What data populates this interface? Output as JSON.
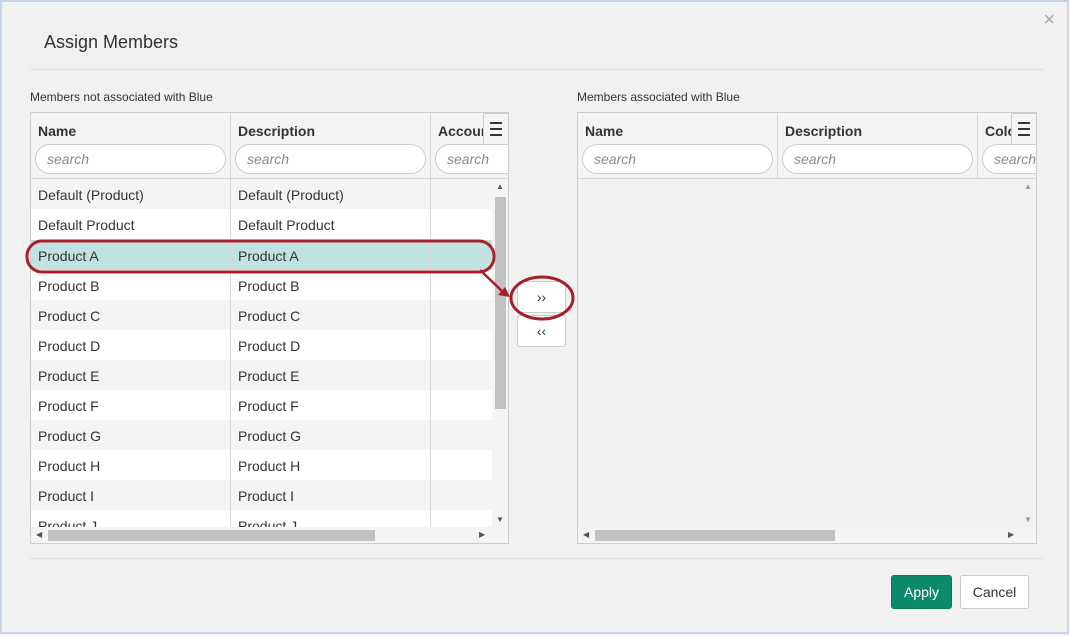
{
  "dialog": {
    "title": "Assign Members",
    "close_label": "×"
  },
  "left": {
    "label": "Members not associated with Blue",
    "columns": [
      {
        "label": "Name",
        "placeholder": "search"
      },
      {
        "label": "Description",
        "placeholder": "search"
      },
      {
        "label": "Account",
        "placeholder": "search"
      }
    ],
    "rows": [
      {
        "name": "Default (Product)",
        "description": "Default (Product)"
      },
      {
        "name": "Default Product",
        "description": "Default Product"
      },
      {
        "name": "Product A",
        "description": "Product A",
        "selected": true
      },
      {
        "name": "Product B",
        "description": "Product B"
      },
      {
        "name": "Product C",
        "description": "Product C"
      },
      {
        "name": "Product D",
        "description": "Product D"
      },
      {
        "name": "Product E",
        "description": "Product E"
      },
      {
        "name": "Product F",
        "description": "Product F"
      },
      {
        "name": "Product G",
        "description": "Product G"
      },
      {
        "name": "Product H",
        "description": "Product H"
      },
      {
        "name": "Product I",
        "description": "Product I"
      },
      {
        "name": "Product J",
        "description": "Product J"
      }
    ]
  },
  "right": {
    "label": "Members associated with Blue",
    "columns": [
      {
        "label": "Name",
        "placeholder": "search"
      },
      {
        "label": "Description",
        "placeholder": "search"
      },
      {
        "label": "Color",
        "placeholder": "search"
      }
    ]
  },
  "transfer": {
    "add_label": "››",
    "remove_label": "‹‹"
  },
  "footer": {
    "apply_label": "Apply",
    "cancel_label": "Cancel"
  },
  "colors": {
    "apply": "#0c8a6b",
    "selected_row": "#c0e3e0",
    "annotation": "#a6202a"
  },
  "icons": {
    "column_menu": "hamburger-menu-icon",
    "close": "close-icon"
  }
}
